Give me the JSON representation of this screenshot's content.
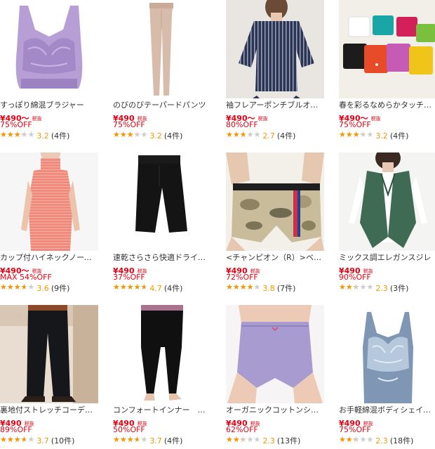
{
  "colors": {
    "price": "#e60012",
    "star_filled": "#f39800",
    "star_empty": "#cccccc",
    "text": "#333333"
  },
  "star_glyph": "★★★★★",
  "products": [
    {
      "name": "すっぽり綿混ブラジャー",
      "price": "¥490〜",
      "tax": "税抜",
      "discount": "75%OFF",
      "rating": 3.2,
      "rating_text": "3.2",
      "reviews": "(4件)",
      "image": "lavender-lace-bra"
    },
    {
      "name": "のびのびテーパードパンツ",
      "price": "¥490",
      "tax": "税抜",
      "discount": "75%OFF",
      "rating": 3.2,
      "rating_text": "3.2",
      "reviews": "(4件)",
      "image": "beige-tapered-pants"
    },
    {
      "name": "袖フレアーポンチブルオーバー",
      "price": "¥490〜",
      "tax": "税抜",
      "discount": "80%OFF",
      "rating": 2.7,
      "rating_text": "2.7",
      "reviews": "(4件)",
      "image": "navy-striped-pullover"
    },
    {
      "name": "春を彩るなめらかタッチセーター",
      "price": "¥490〜",
      "tax": "税抜",
      "discount": "75%OFF",
      "rating": 3.2,
      "rating_text": "3.2",
      "reviews": "(4件)",
      "image": "colorful-sweaters"
    },
    {
      "name": "カップ付ハイネックノースリーブ",
      "price": "¥490〜",
      "tax": "税抜",
      "discount": "MAX 54%OFF",
      "rating": 3.6,
      "rating_text": "3.6",
      "reviews": "(9件)",
      "image": "coral-sleeveless-top"
    },
    {
      "name": "速乾さらさら快適ドライインナー",
      "price": "¥490",
      "tax": "税抜",
      "discount": "37%OFF",
      "rating": 4.7,
      "rating_text": "4.7",
      "reviews": "(4件)",
      "image": "black-cropped-pants"
    },
    {
      "name": "<チャンピオン（R）>ベーシック",
      "price": "¥490",
      "tax": "税抜",
      "discount": "72%OFF",
      "rating": 3.8,
      "rating_text": "3.8",
      "reviews": "(7件)",
      "image": "camo-boxer-shorts"
    },
    {
      "name": "ミックス調エレガンスジレ",
      "price": "¥490",
      "tax": "税抜",
      "discount": "90%OFF",
      "rating": 2.3,
      "rating_text": "2.3",
      "reviews": "(3件)",
      "image": "green-knit-vest"
    },
    {
      "name": "裏地付ストレッチコーデュロイパンツ",
      "price": "¥490",
      "tax": "税抜",
      "discount": "89%OFF",
      "rating": 3.7,
      "rating_text": "3.7",
      "reviews": "(10件)",
      "image": "mens-black-pants"
    },
    {
      "name": "コンフォートインナー　ロングパンツ",
      "price": "¥490",
      "tax": "税抜",
      "discount": "50%OFF",
      "rating": 3.7,
      "rating_text": "3.7",
      "reviews": "(4件)",
      "image": "black-leggings"
    },
    {
      "name": "オーガニックコットンショーツ",
      "price": "¥490",
      "tax": "税抜",
      "discount": "62%OFF",
      "rating": 2.3,
      "rating_text": "2.3",
      "reviews": "(13件)",
      "image": "lavender-shorts"
    },
    {
      "name": "お手軽綿混ボディシェイパー",
      "price": "¥490",
      "tax": "税抜",
      "discount": "75%OFF",
      "rating": 2.3,
      "rating_text": "2.3",
      "reviews": "(18件)",
      "image": "blue-lace-shaper"
    }
  ]
}
